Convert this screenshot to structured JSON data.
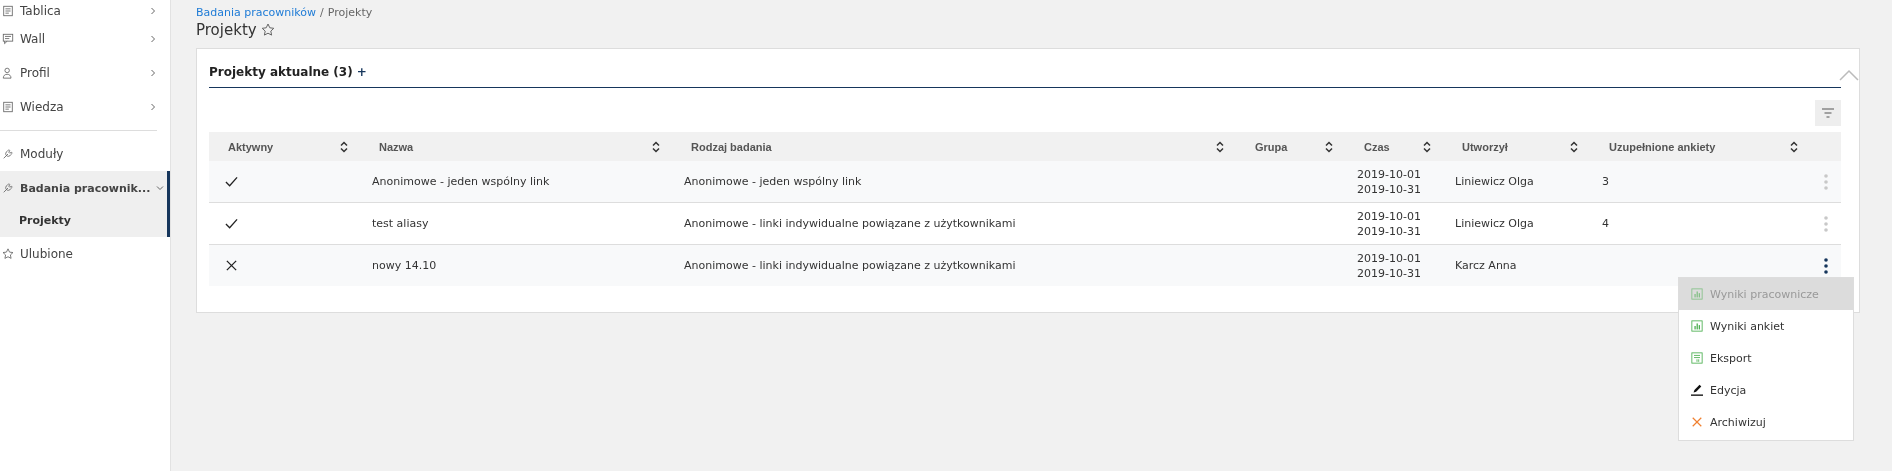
{
  "sidebar": {
    "sections": [
      [
        {
          "label": "Tablica",
          "kind": "group",
          "selected": false
        },
        {
          "label": "Wall",
          "kind": "group",
          "selected": false
        },
        {
          "label": "Profil",
          "kind": "group",
          "selected": false
        },
        {
          "label": "Wiedza",
          "kind": "group",
          "selected": false
        }
      ],
      [
        {
          "label": "Moduły",
          "kind": "link",
          "selected": false
        },
        {
          "label": "Badania pracownik...",
          "kind": "group",
          "expanded": true,
          "selected": true,
          "children": [
            {
              "label": "Projekty",
              "selected": true
            }
          ]
        },
        {
          "label": "Ulubione",
          "kind": "link",
          "selected": false
        }
      ]
    ]
  },
  "breadcrumb": {
    "link": "Badania pracowników",
    "separator": "/",
    "current": "Projekty"
  },
  "page_title": "Projekty",
  "panel": {
    "title": "Projekty aktualne (3)",
    "add": "+",
    "expanded": true
  },
  "table": {
    "columns": [
      "Aktywny",
      "Nazwa",
      "Rodzaj badania",
      "Grupa",
      "Czas",
      "Utworzył",
      "Uzupełnione ankiety"
    ],
    "rows": [
      {
        "active": true,
        "name": "Anonimowe - jeden wspólny link",
        "type": "Anonimowe - jeden wspólny link",
        "group": "",
        "time_from": "2019-10-01",
        "time_to": "2019-10-31",
        "author": "Liniewicz Olga",
        "filled": "3",
        "menu_open": false
      },
      {
        "active": true,
        "name": "test aliasy",
        "type": "Anonimowe - linki indywidualne powiązane z użytkownikami",
        "group": "",
        "time_from": "2019-10-01",
        "time_to": "2019-10-31",
        "author": "Liniewicz Olga",
        "filled": "4",
        "menu_open": false
      },
      {
        "active": false,
        "name": "nowy 14.10",
        "type": "Anonimowe - linki indywidualne powiązane z użytkownikami",
        "group": "",
        "time_from": "2019-10-01",
        "time_to": "2019-10-31",
        "author": "Karcz Anna",
        "filled": "",
        "menu_open": true
      }
    ]
  },
  "row_menu": {
    "items": [
      {
        "label": "Wyniki pracownicze",
        "kind": "chart",
        "disabled": true
      },
      {
        "label": "Wyniki ankiet",
        "kind": "chart",
        "disabled": false
      },
      {
        "label": "Eksport",
        "kind": "export",
        "disabled": false
      },
      {
        "label": "Edycja",
        "kind": "edit",
        "disabled": false
      },
      {
        "label": "Archiwizuj",
        "kind": "archive",
        "disabled": false
      }
    ]
  }
}
